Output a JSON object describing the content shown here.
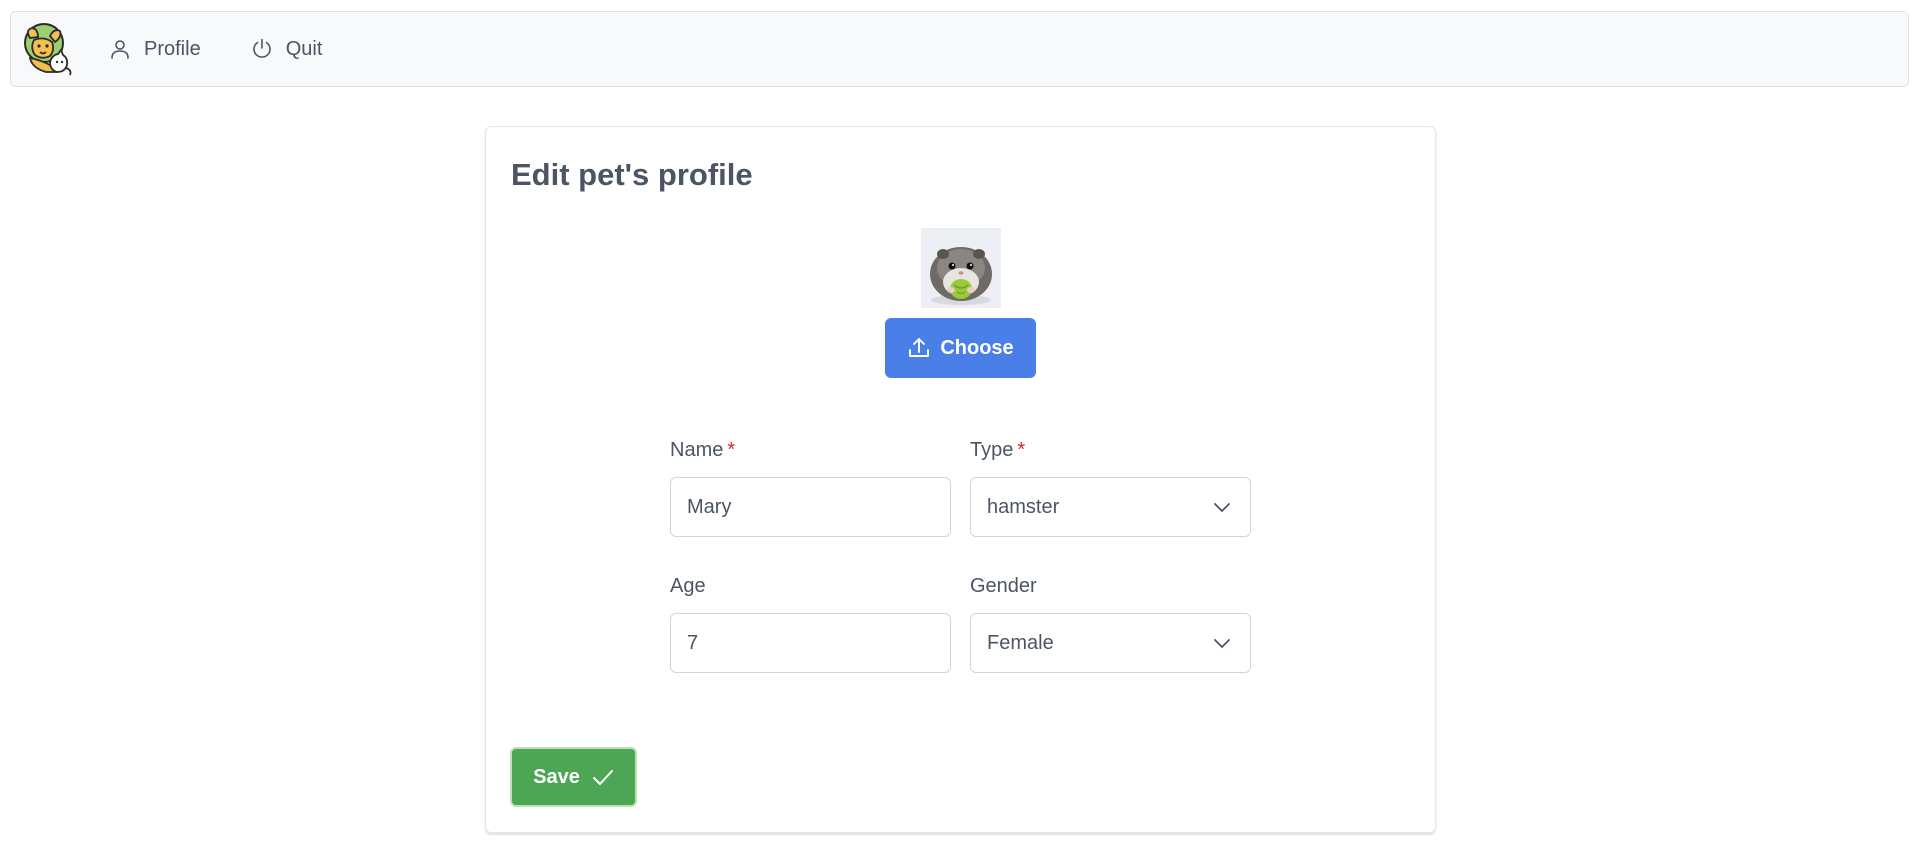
{
  "navbar": {
    "logo_icon": "pets-logo-icon",
    "items": [
      {
        "label": "Profile",
        "icon": "user-icon"
      },
      {
        "label": "Quit",
        "icon": "power-icon"
      }
    ]
  },
  "form": {
    "title": "Edit pet's profile",
    "photo_alt": "hamster-photo",
    "choose_label": "Choose",
    "choose_icon": "upload-icon",
    "fields": {
      "name": {
        "label": "Name",
        "required_mark": "*",
        "value": "Mary"
      },
      "type": {
        "label": "Type",
        "required_mark": "*",
        "value": "hamster"
      },
      "age": {
        "label": "Age",
        "value": "7"
      },
      "gender": {
        "label": "Gender",
        "value": "Female"
      }
    },
    "save_label": "Save",
    "save_icon": "check-icon"
  },
  "colors": {
    "primary": "#4a7fe8",
    "success": "#4ca656",
    "required": "#dc2626",
    "navbar_bg": "#f8f9fa"
  }
}
